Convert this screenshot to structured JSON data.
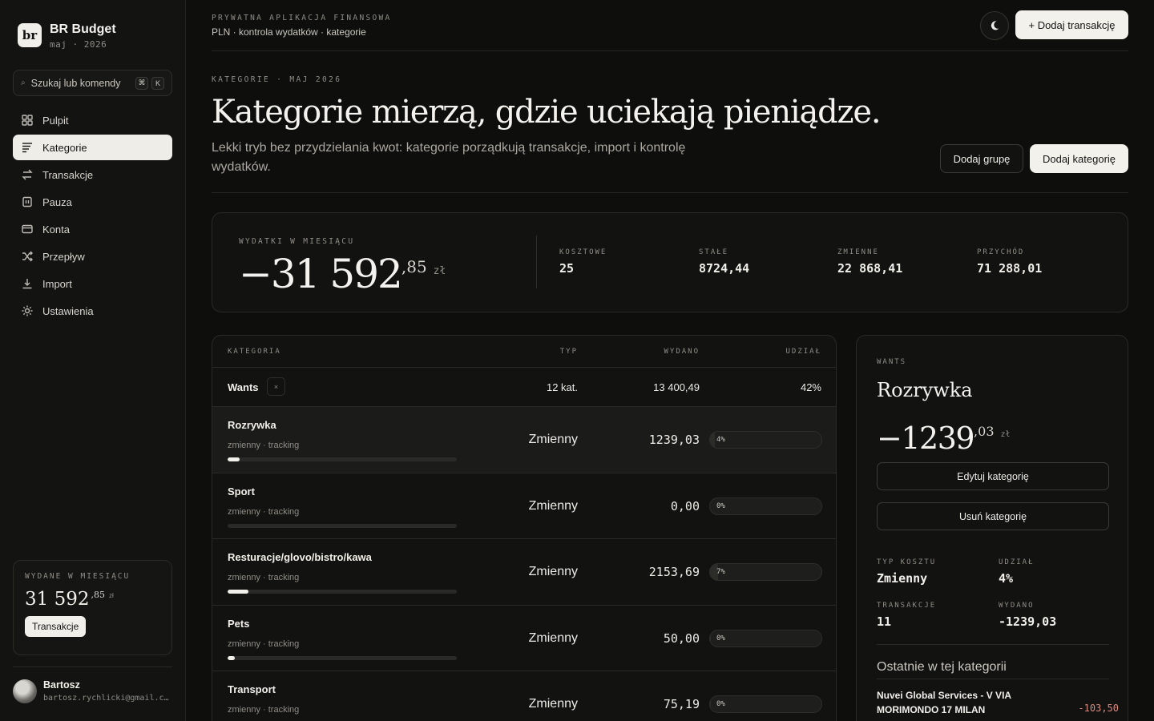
{
  "brand": {
    "logo": "br",
    "name": "BR Budget",
    "sub": "maj · 2026"
  },
  "search": {
    "label": "Szukaj lub komendy",
    "kbd1": "⌘",
    "kbd2": "K"
  },
  "nav": [
    {
      "label": "Pulpit",
      "icon": "grid-icon"
    },
    {
      "label": "Kategorie",
      "icon": "list-icon",
      "active": true
    },
    {
      "label": "Transakcje",
      "icon": "swap-icon"
    },
    {
      "label": "Pauza",
      "icon": "pause-icon"
    },
    {
      "label": "Konta",
      "icon": "card-icon"
    },
    {
      "label": "Przepływ",
      "icon": "shuffle-icon"
    },
    {
      "label": "Import",
      "icon": "download-icon"
    },
    {
      "label": "Ustawienia",
      "icon": "sun-icon"
    }
  ],
  "sidebar_spent": {
    "label": "Wydane w miesiącu",
    "whole": "31 592",
    "cents": ",85",
    "currency": "zł",
    "button": "Transakcje"
  },
  "user": {
    "name": "Bartosz",
    "email": "bartosz.rychlicki@gmail.com"
  },
  "topbar": {
    "eyebrow": "Prywatna aplikacja finansowa",
    "sub": "PLN · kontrola wydatków · kategorie",
    "add_label": "+ Dodaj transakcję"
  },
  "hero": {
    "eyebrow": "Kategorie · maj 2026",
    "title": "Kategorie mierzą, gdzie uciekają pieniądze.",
    "desc": "Lekki tryb bez przydzielania kwot: kategorie porządkują transakcje, import i kontrolę wydatków.",
    "add_group": "Dodaj grupę",
    "add_category": "Dodaj kategorię"
  },
  "summary": {
    "label": "Wydatki w miesiącu",
    "whole": "−31 592",
    "cents": ",85",
    "currency": "zł",
    "stats": [
      {
        "label": "Kosztowe",
        "value": "25"
      },
      {
        "label": "Stałe",
        "value": "8724,44"
      },
      {
        "label": "Zmienne",
        "value": "22 868,41"
      },
      {
        "label": "Przychód",
        "value": "71 288,01"
      }
    ]
  },
  "table": {
    "headers": {
      "category": "Kategoria",
      "type": "Typ",
      "spent": "Wydano",
      "share": "Udział"
    },
    "group": {
      "name": "Wants",
      "close": "×",
      "count": "12 kat.",
      "sum": "13 400,49",
      "share": "42%"
    },
    "rows": [
      {
        "name": "Rozrywka",
        "meta": "zmienny · tracking",
        "type": "Zmienny",
        "spent": "1239,03",
        "share_label": "4%",
        "share": 0.04,
        "selected": true
      },
      {
        "name": "Sport",
        "meta": "zmienny · tracking",
        "type": "Zmienny",
        "spent": "0,00",
        "share_label": "0%",
        "share": 0.0
      },
      {
        "name": "Resturacje/glovo/bistro/kawa",
        "meta": "zmienny · tracking",
        "type": "Zmienny",
        "spent": "2153,69",
        "share_label": "7%",
        "share": 0.07
      },
      {
        "name": "Pets",
        "meta": "zmienny · tracking",
        "type": "Zmienny",
        "spent": "50,00",
        "share_label": "0%",
        "share": 0.004
      },
      {
        "name": "Transport",
        "meta": "zmienny · tracking",
        "type": "Zmienny",
        "spent": "75,19",
        "share_label": "0%",
        "share": 0.006
      }
    ]
  },
  "detail": {
    "eyebrow": "Wants",
    "title": "Rozrywka",
    "whole": "−1239",
    "cents": ",03",
    "currency": "zł",
    "edit": "Edytuj kategorię",
    "delete": "Usuń kategorię",
    "cost_type_label": "Typ kosztu",
    "cost_type": "Zmienny",
    "share_label": "Udział",
    "share": "4%",
    "tx_label": "Transakcje",
    "tx_count": "11",
    "spent_label": "Wydano",
    "spent": "-1239,03",
    "recent_title": "Ostatnie w tej kategorii",
    "recent": {
      "name": "Nuvei Global Services - V VIA MORIMONDO 17 MILAN",
      "amount": "-103,50"
    }
  }
}
